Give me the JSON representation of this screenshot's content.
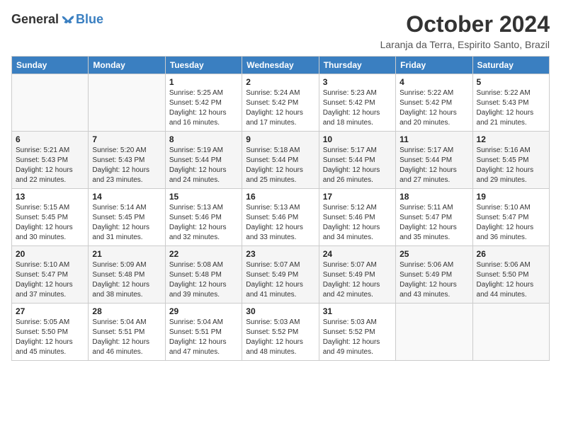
{
  "logo": {
    "general": "General",
    "blue": "Blue"
  },
  "title": "October 2024",
  "location": "Laranja da Terra, Espirito Santo, Brazil",
  "weekdays": [
    "Sunday",
    "Monday",
    "Tuesday",
    "Wednesday",
    "Thursday",
    "Friday",
    "Saturday"
  ],
  "weeks": [
    [
      null,
      null,
      {
        "day": "1",
        "sunrise": "Sunrise: 5:25 AM",
        "sunset": "Sunset: 5:42 PM",
        "daylight": "Daylight: 12 hours and 16 minutes."
      },
      {
        "day": "2",
        "sunrise": "Sunrise: 5:24 AM",
        "sunset": "Sunset: 5:42 PM",
        "daylight": "Daylight: 12 hours and 17 minutes."
      },
      {
        "day": "3",
        "sunrise": "Sunrise: 5:23 AM",
        "sunset": "Sunset: 5:42 PM",
        "daylight": "Daylight: 12 hours and 18 minutes."
      },
      {
        "day": "4",
        "sunrise": "Sunrise: 5:22 AM",
        "sunset": "Sunset: 5:42 PM",
        "daylight": "Daylight: 12 hours and 20 minutes."
      },
      {
        "day": "5",
        "sunrise": "Sunrise: 5:22 AM",
        "sunset": "Sunset: 5:43 PM",
        "daylight": "Daylight: 12 hours and 21 minutes."
      }
    ],
    [
      {
        "day": "6",
        "sunrise": "Sunrise: 5:21 AM",
        "sunset": "Sunset: 5:43 PM",
        "daylight": "Daylight: 12 hours and 22 minutes."
      },
      {
        "day": "7",
        "sunrise": "Sunrise: 5:20 AM",
        "sunset": "Sunset: 5:43 PM",
        "daylight": "Daylight: 12 hours and 23 minutes."
      },
      {
        "day": "8",
        "sunrise": "Sunrise: 5:19 AM",
        "sunset": "Sunset: 5:44 PM",
        "daylight": "Daylight: 12 hours and 24 minutes."
      },
      {
        "day": "9",
        "sunrise": "Sunrise: 5:18 AM",
        "sunset": "Sunset: 5:44 PM",
        "daylight": "Daylight: 12 hours and 25 minutes."
      },
      {
        "day": "10",
        "sunrise": "Sunrise: 5:17 AM",
        "sunset": "Sunset: 5:44 PM",
        "daylight": "Daylight: 12 hours and 26 minutes."
      },
      {
        "day": "11",
        "sunrise": "Sunrise: 5:17 AM",
        "sunset": "Sunset: 5:44 PM",
        "daylight": "Daylight: 12 hours and 27 minutes."
      },
      {
        "day": "12",
        "sunrise": "Sunrise: 5:16 AM",
        "sunset": "Sunset: 5:45 PM",
        "daylight": "Daylight: 12 hours and 29 minutes."
      }
    ],
    [
      {
        "day": "13",
        "sunrise": "Sunrise: 5:15 AM",
        "sunset": "Sunset: 5:45 PM",
        "daylight": "Daylight: 12 hours and 30 minutes."
      },
      {
        "day": "14",
        "sunrise": "Sunrise: 5:14 AM",
        "sunset": "Sunset: 5:45 PM",
        "daylight": "Daylight: 12 hours and 31 minutes."
      },
      {
        "day": "15",
        "sunrise": "Sunrise: 5:13 AM",
        "sunset": "Sunset: 5:46 PM",
        "daylight": "Daylight: 12 hours and 32 minutes."
      },
      {
        "day": "16",
        "sunrise": "Sunrise: 5:13 AM",
        "sunset": "Sunset: 5:46 PM",
        "daylight": "Daylight: 12 hours and 33 minutes."
      },
      {
        "day": "17",
        "sunrise": "Sunrise: 5:12 AM",
        "sunset": "Sunset: 5:46 PM",
        "daylight": "Daylight: 12 hours and 34 minutes."
      },
      {
        "day": "18",
        "sunrise": "Sunrise: 5:11 AM",
        "sunset": "Sunset: 5:47 PM",
        "daylight": "Daylight: 12 hours and 35 minutes."
      },
      {
        "day": "19",
        "sunrise": "Sunrise: 5:10 AM",
        "sunset": "Sunset: 5:47 PM",
        "daylight": "Daylight: 12 hours and 36 minutes."
      }
    ],
    [
      {
        "day": "20",
        "sunrise": "Sunrise: 5:10 AM",
        "sunset": "Sunset: 5:47 PM",
        "daylight": "Daylight: 12 hours and 37 minutes."
      },
      {
        "day": "21",
        "sunrise": "Sunrise: 5:09 AM",
        "sunset": "Sunset: 5:48 PM",
        "daylight": "Daylight: 12 hours and 38 minutes."
      },
      {
        "day": "22",
        "sunrise": "Sunrise: 5:08 AM",
        "sunset": "Sunset: 5:48 PM",
        "daylight": "Daylight: 12 hours and 39 minutes."
      },
      {
        "day": "23",
        "sunrise": "Sunrise: 5:07 AM",
        "sunset": "Sunset: 5:49 PM",
        "daylight": "Daylight: 12 hours and 41 minutes."
      },
      {
        "day": "24",
        "sunrise": "Sunrise: 5:07 AM",
        "sunset": "Sunset: 5:49 PM",
        "daylight": "Daylight: 12 hours and 42 minutes."
      },
      {
        "day": "25",
        "sunrise": "Sunrise: 5:06 AM",
        "sunset": "Sunset: 5:49 PM",
        "daylight": "Daylight: 12 hours and 43 minutes."
      },
      {
        "day": "26",
        "sunrise": "Sunrise: 5:06 AM",
        "sunset": "Sunset: 5:50 PM",
        "daylight": "Daylight: 12 hours and 44 minutes."
      }
    ],
    [
      {
        "day": "27",
        "sunrise": "Sunrise: 5:05 AM",
        "sunset": "Sunset: 5:50 PM",
        "daylight": "Daylight: 12 hours and 45 minutes."
      },
      {
        "day": "28",
        "sunrise": "Sunrise: 5:04 AM",
        "sunset": "Sunset: 5:51 PM",
        "daylight": "Daylight: 12 hours and 46 minutes."
      },
      {
        "day": "29",
        "sunrise": "Sunrise: 5:04 AM",
        "sunset": "Sunset: 5:51 PM",
        "daylight": "Daylight: 12 hours and 47 minutes."
      },
      {
        "day": "30",
        "sunrise": "Sunrise: 5:03 AM",
        "sunset": "Sunset: 5:52 PM",
        "daylight": "Daylight: 12 hours and 48 minutes."
      },
      {
        "day": "31",
        "sunrise": "Sunrise: 5:03 AM",
        "sunset": "Sunset: 5:52 PM",
        "daylight": "Daylight: 12 hours and 49 minutes."
      },
      null,
      null
    ]
  ]
}
